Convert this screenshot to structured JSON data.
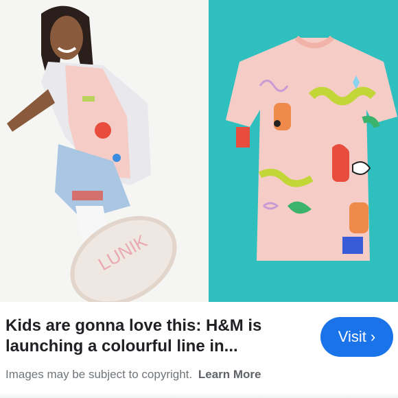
{
  "result": {
    "title": "Kids are gonna love this: H&M is launching a colourful line in...",
    "visit_label": "Visit",
    "copyright_text": "Images may be subject to copyright.",
    "learn_more_label": "Learn More"
  },
  "images": {
    "left_alt": "Girl kicking wearing pink patterned shirt and sneakers",
    "right_alt": "Pink oversized t-shirt with colorful doodle print"
  },
  "colors": {
    "accent": "#1a73e8",
    "right_bg": "#2fbfbe",
    "shirt": "#f5cdc6"
  }
}
